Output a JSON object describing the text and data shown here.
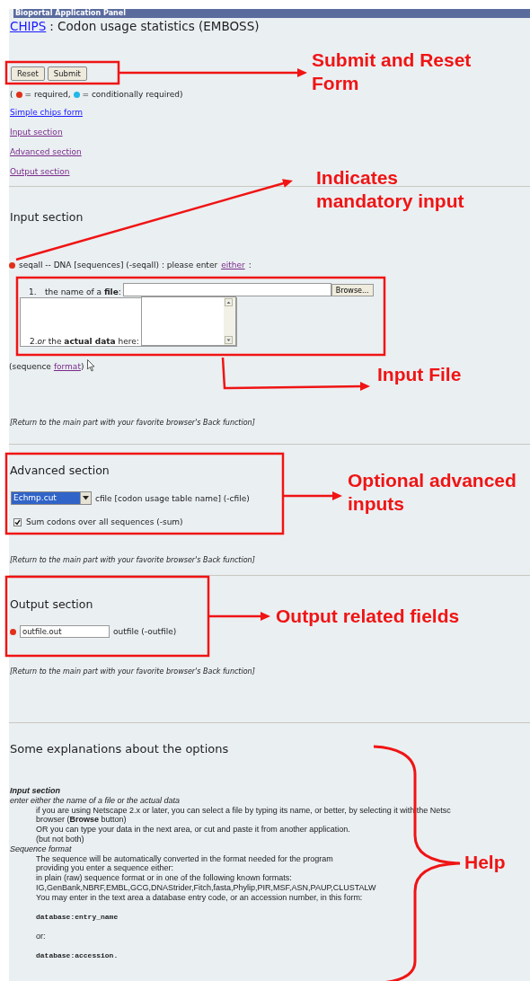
{
  "title_bar": {
    "title": "Bioportal Application Panel"
  },
  "header": {
    "link": "CHIPS",
    "title": ": Codon usage statistics (EMBOSS)"
  },
  "form_buttons": [
    {
      "label": "Reset"
    },
    {
      "label": "Submit"
    }
  ],
  "legend": {
    "open": "(",
    "items": [
      {
        "kind": "required",
        "text": "= required,"
      },
      {
        "kind": "conditional",
        "text": "= conditionally required)"
      }
    ]
  },
  "links": [
    {
      "text": "Simple chips form",
      "visited": false
    },
    {
      "text": "Input section",
      "visited": true
    },
    {
      "text": "Advanced section",
      "visited": true
    },
    {
      "text": "Output section",
      "visited": true
    }
  ],
  "input_section": {
    "heading": "Input section",
    "param": {
      "required": true,
      "text": "seqall -- DNA [sequences] (-seqall) : please enter",
      "link": "either",
      "end": ":"
    },
    "options": [
      {
        "number": "1.",
        "label": "the name of a **file**:",
        "kind": "file"
      },
      {
        "number": "2.",
        "label": "*or* the **actual data** here:",
        "kind": "textarea"
      }
    ],
    "browse_button": "Browse...",
    "format_note": {
      "open": "(sequence",
      "link": "format",
      "close": ")"
    },
    "return_note": "[Return to the main part with your favorite browser's Back function]"
  },
  "advanced_section": {
    "heading": "Advanced section",
    "select_value": "Echmp.cut",
    "select_label": "cfile [codon usage table name] (-cfile)",
    "checkbox": {
      "label": "Sum codons over all sequences (-sum)",
      "checked": true
    },
    "return_note": "[Return to the main part with your favorite browser's Back function]"
  },
  "output_section": {
    "heading": "Output section",
    "required": true,
    "field_value": "outfile.out",
    "field_label": "outfile (-outfile)",
    "return_note": "[Return to the main part with your favorite browser's Back function]"
  },
  "help": {
    "heading": "Some explanations about the options",
    "entries": [
      {
        "kind": "section",
        "text": "Input section"
      },
      {
        "kind": "topic",
        "text": "enter either the name of a file or the actual data"
      },
      {
        "kind": "body",
        "text": "if you are using Netscape 2.x or later, you can select a file by typing its name, or better, by selecting it with the Netsc"
      },
      {
        "kind": "body",
        "text": "browser (**Browse** button)"
      },
      {
        "kind": "body",
        "text": "OR you can type your data in the next area, or cut and paste it from another application."
      },
      {
        "kind": "body",
        "text": "(but not both)"
      },
      {
        "kind": "topic",
        "text": "Sequence format"
      },
      {
        "kind": "body",
        "text": "The sequence will be automatically converted in the format needed for the program"
      },
      {
        "kind": "body",
        "text": "providing you enter a sequence either:"
      },
      {
        "kind": "body",
        "text": "in plain (raw) sequence format or in one of the following known formats:"
      },
      {
        "kind": "body",
        "text": "IG,GenBank,NBRF,EMBL,GCG,DNAStrider,Fitch,fasta,Phylip,PIR,MSF,ASN,PAUP,CLUSTALW"
      },
      {
        "kind": "body",
        "text": "You may enter in the text area a database entry code, or an accession number, in this form:"
      },
      {
        "kind": "code",
        "text": "database:entry_name"
      },
      {
        "kind": "body",
        "text": "or:"
      },
      {
        "kind": "code",
        "text": "database:accession."
      }
    ]
  },
  "annotations": [
    {
      "kind": "framed_arrow",
      "label_lines": [
        "Submit and Reset",
        "Form"
      ]
    },
    {
      "kind": "pointer",
      "label_lines": [
        "Indicates",
        "mandatory input"
      ]
    },
    {
      "kind": "framed_elbow",
      "label_lines": [
        "Input File"
      ]
    },
    {
      "kind": "framed_arrow",
      "label_lines": [
        "Optional advanced",
        "inputs"
      ]
    },
    {
      "kind": "framed_arrow",
      "label_lines": [
        "Output related fields"
      ]
    },
    {
      "kind": "brace",
      "label_lines": [
        "Help"
      ]
    }
  ]
}
